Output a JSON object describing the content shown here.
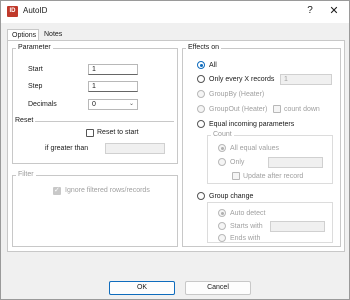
{
  "window": {
    "title": "AutoID",
    "icon_name": "app-icon",
    "help_glyph": "?",
    "close_glyph": "✕"
  },
  "tabs": [
    {
      "label": "Options"
    },
    {
      "label": "Notes"
    }
  ],
  "parameter": {
    "title": "Parameter",
    "start_label": "Start",
    "start_value": "1",
    "step_label": "Step",
    "step_value": "1",
    "decimals_label": "Decimals",
    "decimals_value": "0"
  },
  "reset": {
    "title": "Reset",
    "reset_to_start_label": "Reset to start",
    "if_greater_than_label": "if greater than",
    "if_greater_than_value": ""
  },
  "filter": {
    "title": "Filter",
    "ignore_label": "Ignore filtered rows/records",
    "ignore_checked": true
  },
  "effects": {
    "title": "Effects on",
    "all_label": "All",
    "only_every_label": "Only every X records",
    "only_every_value": "1",
    "groupby_label": "GroupBy (Heater)",
    "groupout_label": "GroupOut (Heater)",
    "count_down_label": "count down",
    "equal_incoming_label": "Equal incoming parameters",
    "count_group_title": "Count",
    "all_equal_label": "All equal values",
    "only_label": "Only",
    "update_after_label": "Update after record",
    "group_change_label": "Group change",
    "auto_detect_label": "Auto detect",
    "starts_with_label": "Starts with",
    "ends_with_label": "Ends with"
  },
  "buttons": {
    "ok": "OK",
    "cancel": "Cancel"
  },
  "colors": {
    "accent": "#0f6cbd",
    "app_icon": "#c0392b"
  }
}
